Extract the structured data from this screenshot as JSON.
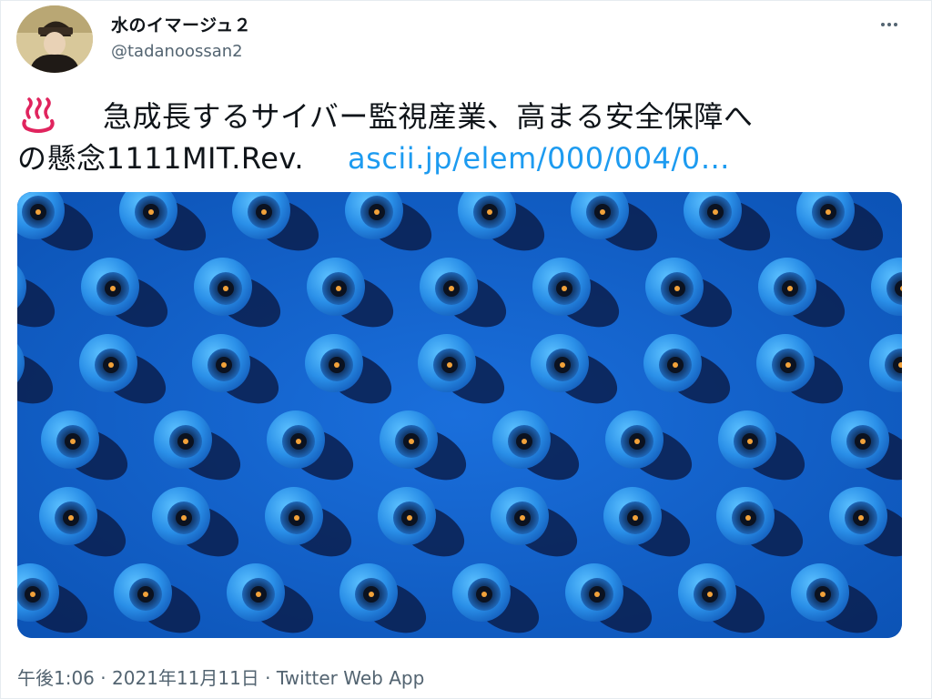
{
  "user": {
    "display_name": "水のイマージュ２",
    "handle": "@tadanoossan2",
    "avatar_icon": "user-avatar-icon"
  },
  "menu": {
    "more_icon": "more-dots-icon"
  },
  "tweet": {
    "emoji_icon": "hot-springs-icon",
    "text_part1": "急成長するサイバー監視産業、高まる安全保障へ",
    "text_part2": "の懸念1111MIT.Rev.",
    "link_text": "ascii.jp/elem/000/004/0…"
  },
  "media": {
    "description_icon": "eyeball-pattern-image",
    "background_color": "#0c5cc4"
  },
  "meta": {
    "time": "午後1:06",
    "date": "2021年11月11日",
    "source": "Twitter Web App",
    "separator": " · "
  },
  "colors": {
    "text": "#0f1419",
    "secondary": "#536471",
    "link": "#1d9bf0",
    "emoji": "#e0245e"
  }
}
